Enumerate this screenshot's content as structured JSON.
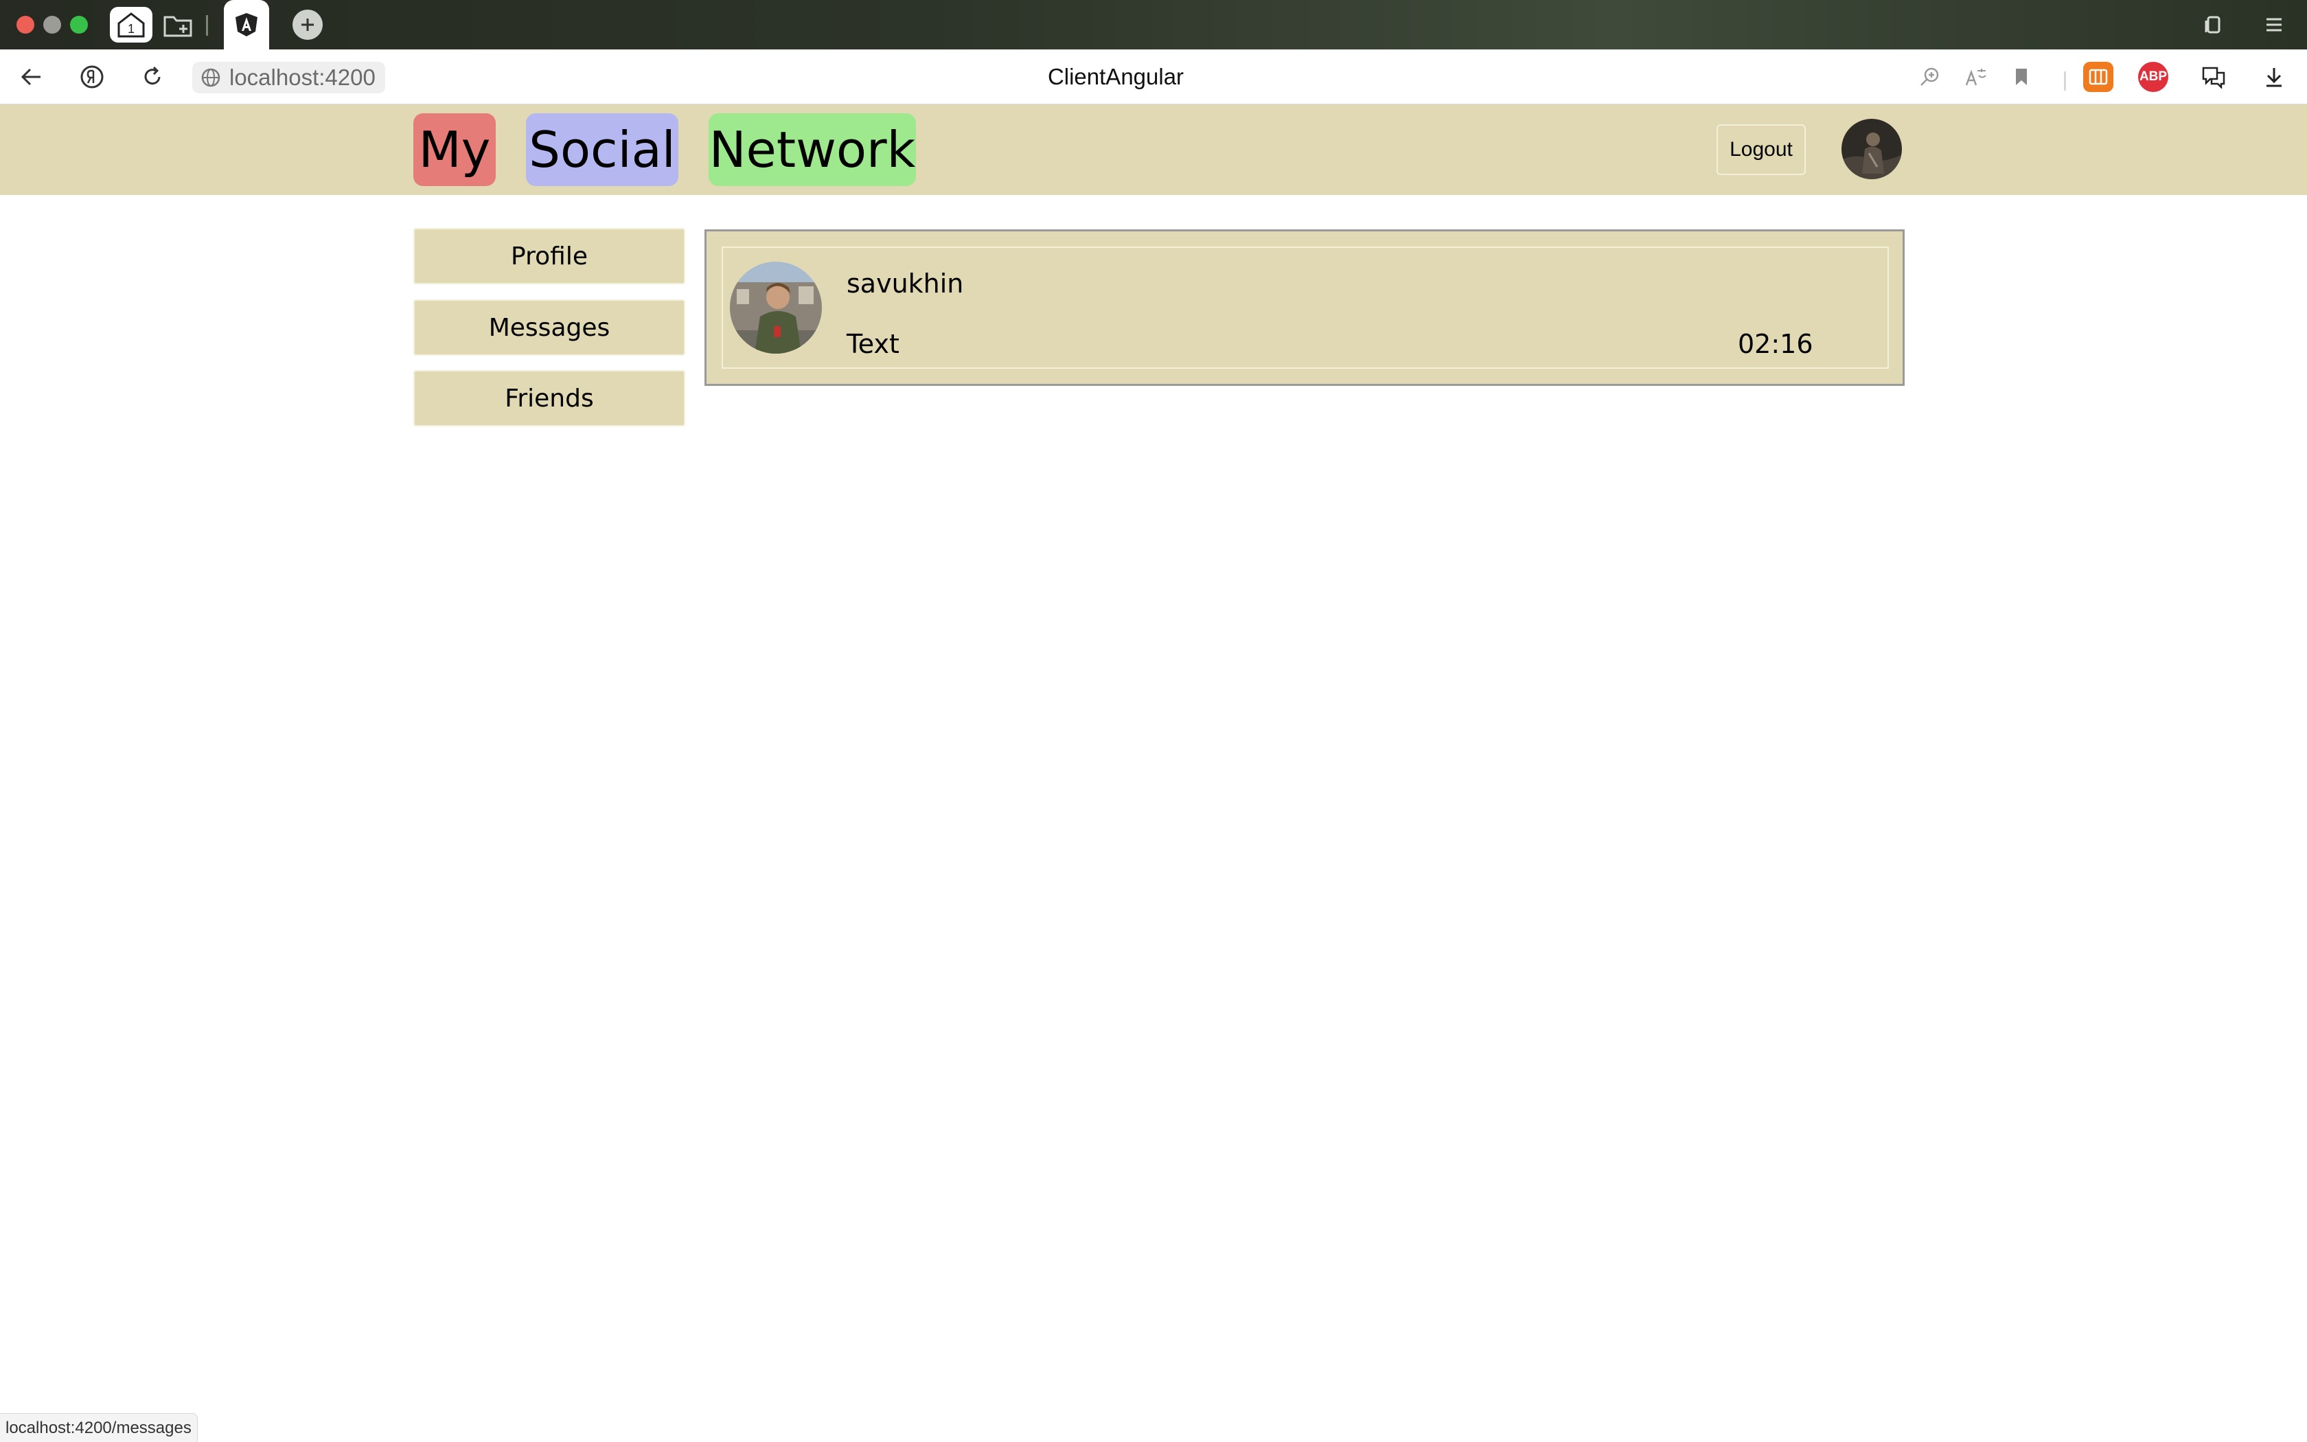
{
  "browser": {
    "address_url": "localhost:4200",
    "page_title": "ClientAngular",
    "home_tab_badge": "1",
    "ext_abp_label": "ABP",
    "status_url": "localhost:4200/messages"
  },
  "header": {
    "logo_words": [
      "My",
      "Social",
      "Network"
    ],
    "logo_colors": [
      "#e57c78",
      "#b5b7f1",
      "#9ee98d"
    ],
    "logout_label": "Logout"
  },
  "sidebar": {
    "items": [
      {
        "label": "Profile"
      },
      {
        "label": "Messages"
      },
      {
        "label": "Friends"
      }
    ]
  },
  "messages": [
    {
      "username": "savukhin",
      "text": "Text",
      "time": "02:16"
    }
  ],
  "colors": {
    "header_bg": "#e0d9b4",
    "panel_border": "#9a9a9a"
  }
}
